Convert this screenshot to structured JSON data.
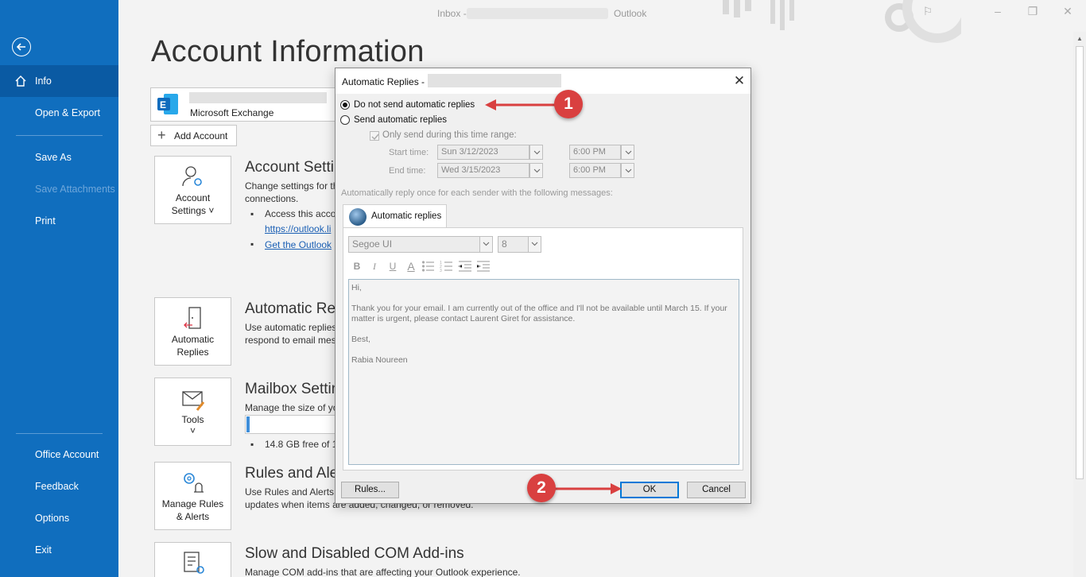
{
  "titlebar": {
    "inbox": "Inbox -",
    "app": "Outlook"
  },
  "sidebar": {
    "items": [
      {
        "label": "Info"
      },
      {
        "label": "Open & Export"
      },
      {
        "label": "Save As"
      },
      {
        "label": "Save Attachments"
      },
      {
        "label": "Print"
      },
      {
        "label": "Office Account"
      },
      {
        "label": "Feedback"
      },
      {
        "label": "Options"
      },
      {
        "label": "Exit"
      }
    ]
  },
  "main": {
    "title": "Account Information",
    "account_type": "Microsoft Exchange",
    "add_account": "Add Account",
    "tiles": {
      "account_settings": [
        "Account",
        "Settings ˅"
      ],
      "automatic_replies": [
        "Automatic",
        "Replies"
      ],
      "tools": [
        "Tools",
        "˅"
      ],
      "manage_rules": [
        "Manage Rules",
        "& Alerts"
      ]
    },
    "sections": {
      "account_settings": {
        "heading": "Account Settin",
        "text1": "Change settings for th",
        "text2": "connections.",
        "bullet1": "Access this accou",
        "link1": "https://outlook.li",
        "link2": "Get the Outlook"
      },
      "automatic_replies": {
        "heading": "Automatic Rep",
        "text1": "Use automatic replies",
        "text2": "respond to email mes"
      },
      "mailbox": {
        "heading": "Mailbox Settin",
        "text1": "Manage the size of yo",
        "bullet": "14.8 GB free of 14",
        "usage_fraction": 0.04
      },
      "rules": {
        "heading": "Rules and Aler",
        "text1": "Use Rules and Alerts to",
        "text2": "updates when items are added, changed, or removed."
      },
      "com": {
        "heading": "Slow and Disabled COM Add-ins",
        "text1": "Manage COM add-ins that are affecting your Outlook experience."
      }
    }
  },
  "dialog": {
    "title": "Automatic Replies -",
    "opt_no_send": "Do not send automatic replies",
    "opt_send": "Send automatic replies",
    "only_range": "Only send during this time range:",
    "start_label": "Start time:",
    "end_label": "End time:",
    "start_date": "Sun 3/12/2023",
    "end_date": "Wed 3/15/2023",
    "start_time": "6:00 PM",
    "end_time": "6:00 PM",
    "auto_desc": "Automatically reply once for each sender with the following messages:",
    "tab_label": "Automatic replies",
    "font": "Segoe UI",
    "font_size": "8",
    "format_buttons": [
      "B",
      "I",
      "U",
      "A"
    ],
    "message": [
      "Hi,",
      "Thank you for your email. I am currently out of the office and I'll not be available until March 15. If your matter is urgent, please contact Laurent Giret for assistance.",
      "Best,",
      "Rabia Noureen"
    ],
    "rules_btn": "Rules...",
    "ok_btn": "OK",
    "cancel_btn": "Cancel"
  },
  "annotations": {
    "step1": "1",
    "step2": "2",
    "color": "#d94040"
  },
  "colors": {
    "sidebar": "#106ebe",
    "sidebar_active": "#0a5aa3",
    "accent": "#0078d7"
  }
}
